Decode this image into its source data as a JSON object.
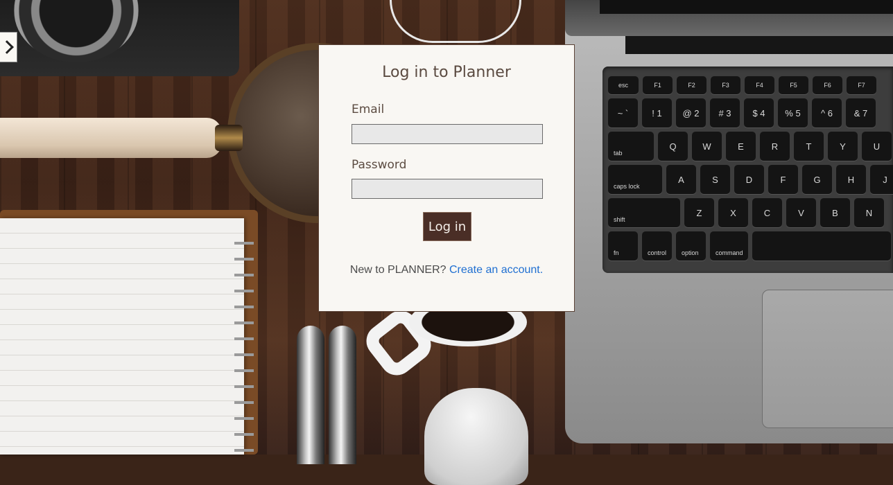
{
  "login": {
    "title": "Log in to Planner",
    "email_label": "Email",
    "email_value": "",
    "password_label": "Password",
    "password_value": "",
    "submit_label": "Log in",
    "signup_prompt": "New to PLANNER?",
    "signup_link": "Create an account."
  },
  "keyboard": {
    "fn_row": [
      "esc",
      "F1",
      "F2",
      "F3",
      "F4",
      "F5",
      "F6",
      "F7"
    ],
    "number_row": [
      "~ `",
      "! 1",
      "@ 2",
      "# 3",
      "$ 4",
      "% 5",
      "^ 6",
      "& 7"
    ],
    "qwerty_row": [
      "tab",
      "Q",
      "W",
      "E",
      "R",
      "T",
      "Y",
      "U"
    ],
    "home_row": [
      "caps lock",
      "A",
      "S",
      "D",
      "F",
      "G",
      "H",
      "J"
    ],
    "shift_row": [
      "shift",
      "Z",
      "X",
      "C",
      "V",
      "B",
      "N"
    ],
    "bottom_row": [
      "fn",
      "control",
      "option",
      "command"
    ]
  },
  "colors": {
    "card_bg": "#f9f7f3",
    "button_bg": "#4a2e26",
    "link": "#1f6fd1"
  },
  "icons": {
    "sidebar_toggle": "chevron-right-icon"
  }
}
